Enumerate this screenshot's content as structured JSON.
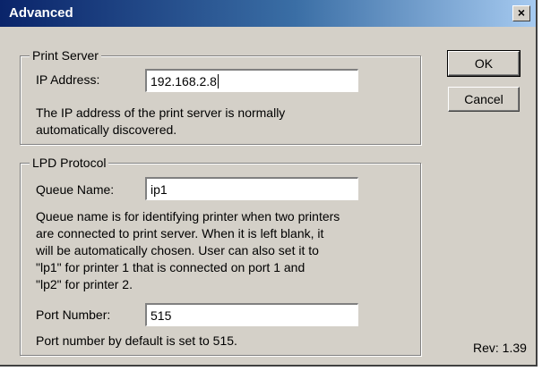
{
  "window": {
    "title": "Advanced",
    "close_glyph": "×"
  },
  "print_server": {
    "group_label": "Print Server",
    "ip_label": "IP Address:",
    "ip_value": "192.168.2.8",
    "description_lines": [
      "The IP address of the print server is normally",
      "automatically discovered."
    ]
  },
  "lpd": {
    "group_label": "LPD Protocol",
    "queue_label": "Queue Name:",
    "queue_value": "ip1",
    "queue_description_lines": [
      "Queue name is for identifying printer when two printers",
      "are connected to print server. When it is left blank, it",
      "will be automatically chosen. User can also set it to",
      "\"lp1\" for printer 1 that is connected on port 1 and",
      "\"lp2\" for printer 2."
    ],
    "port_label": "Port Number:",
    "port_value": "515",
    "port_description": "Port number by default is set to 515."
  },
  "buttons": {
    "ok": "OK",
    "cancel": "Cancel"
  },
  "revision": "Rev: 1.39",
  "colors": {
    "face": "#d4d0c8",
    "title_start": "#0a246a",
    "title_end": "#a6caf0"
  },
  "icons": {
    "close": "close-icon"
  }
}
